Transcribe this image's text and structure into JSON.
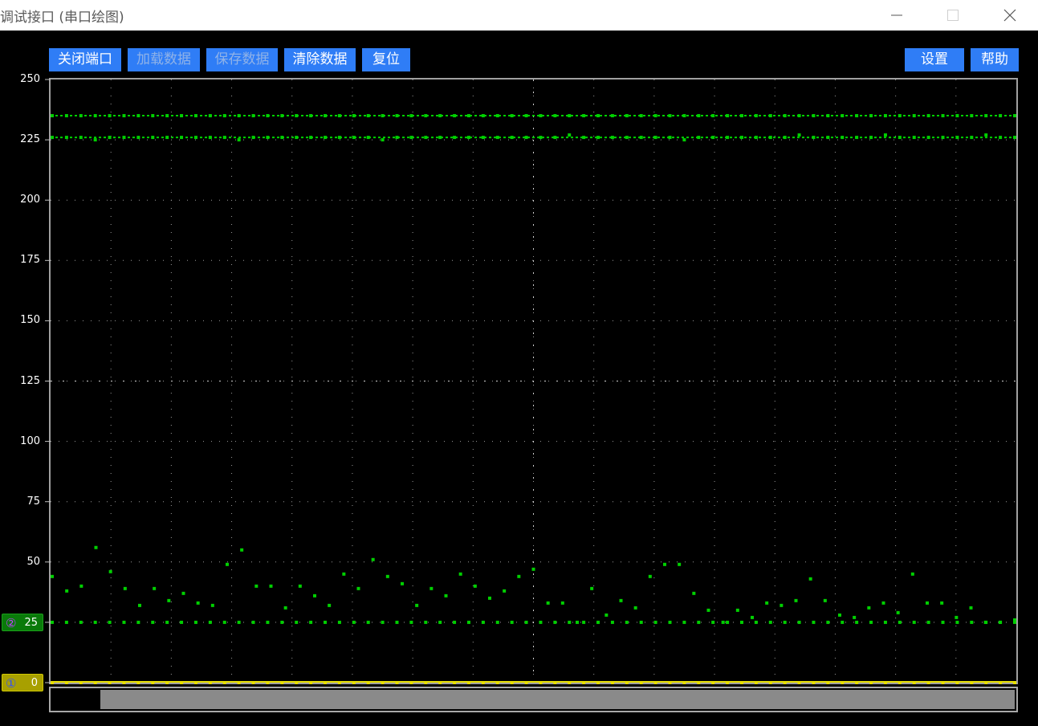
{
  "window": {
    "title": "调试接口 (串口绘图)",
    "minimize_icon": "minimize-icon",
    "maximize_icon": "maximize-icon",
    "close_icon": "close-icon"
  },
  "toolbar": {
    "close_port": "关闭端口",
    "load_data": "加载数据",
    "save_data": "保存数据",
    "clear_data": "清除数据",
    "reset": "复位",
    "settings": "设置",
    "help": "帮助"
  },
  "colors": {
    "button_bg": "#2f7df6",
    "grid": "#9a9a9a",
    "series_1": "#e8e000",
    "series_2": "#00d000",
    "series_2_marker_bg": "#0a7a0a",
    "series_1_marker_bg": "#a8a000"
  },
  "channels": [
    {
      "number": "②",
      "value": "25"
    },
    {
      "number": "①",
      "value": "0"
    }
  ],
  "chart_data": {
    "type": "scatter",
    "ylim": [
      0,
      250
    ],
    "yticks": [
      "250",
      "225",
      "200",
      "175",
      "150",
      "125",
      "100",
      "75",
      "50",
      "25",
      "0"
    ],
    "grid": true,
    "series": [
      {
        "color": "#00d000",
        "values": [
          235,
          235,
          235,
          235,
          235,
          235,
          235,
          235,
          235,
          235,
          235,
          235,
          235,
          235,
          235,
          235,
          235,
          235,
          235,
          235,
          235,
          235,
          235,
          235,
          235,
          235,
          235,
          235,
          235,
          235,
          235,
          235,
          235,
          235,
          235,
          235,
          235,
          235,
          235,
          235,
          235,
          235,
          235,
          235,
          235,
          235,
          235,
          235,
          235,
          235,
          235,
          235,
          235,
          235,
          235,
          235,
          235,
          235,
          235,
          235,
          235,
          235,
          235,
          235,
          235,
          235,
          235,
          235
        ]
      },
      {
        "color": "#00d000",
        "values": [
          226,
          226,
          226,
          225,
          226,
          226,
          226,
          226,
          226,
          226,
          226,
          226,
          226,
          225,
          226,
          226,
          226,
          226,
          226,
          226,
          226,
          226,
          226,
          225,
          226,
          226,
          226,
          226,
          226,
          226,
          226,
          226,
          226,
          226,
          226,
          226,
          227,
          226,
          226,
          226,
          226,
          226,
          226,
          226,
          225,
          226,
          226,
          226,
          226,
          226,
          226,
          226,
          227,
          226,
          226,
          226,
          226,
          226,
          227,
          226,
          226,
          226,
          226,
          226,
          226,
          227,
          226,
          226
        ]
      },
      {
        "color": "#00d000",
        "values": [
          44,
          38,
          40,
          56,
          46,
          39,
          32,
          39,
          34,
          37,
          33,
          32,
          49,
          55,
          40,
          40,
          31,
          40,
          36,
          32,
          45,
          39,
          51,
          44,
          41,
          32,
          39,
          36,
          45,
          40,
          35,
          38,
          44,
          47,
          33,
          33,
          25,
          39,
          28,
          34,
          31,
          44,
          49,
          49,
          37,
          30,
          25,
          30,
          27,
          33,
          32,
          34,
          43,
          34,
          28,
          27,
          31,
          33,
          29,
          45,
          33,
          33,
          27,
          31,
          25,
          25,
          26
        ]
      },
      {
        "color": "#00d000",
        "values": [
          25,
          25,
          25,
          25,
          25,
          25,
          25,
          25,
          25,
          25,
          25,
          25,
          25,
          25,
          25,
          25,
          25,
          25,
          25,
          25,
          25,
          25,
          25,
          25,
          25,
          25,
          25,
          25,
          25,
          25,
          25,
          25,
          25,
          25,
          25,
          25,
          25,
          25,
          25,
          25,
          25,
          25,
          25,
          25,
          25,
          25,
          25,
          25,
          25,
          25,
          25,
          25,
          25,
          25,
          25,
          25,
          25,
          25,
          25,
          25,
          25,
          25,
          25,
          25,
          25,
          25,
          25,
          25
        ]
      },
      {
        "color": "#e8e000",
        "values": [
          0,
          0,
          0,
          0,
          0,
          0,
          0,
          0,
          0,
          0,
          0,
          0,
          0,
          0,
          0,
          0,
          0,
          0,
          0,
          0,
          0,
          0,
          0,
          0,
          0,
          0,
          0,
          0,
          0,
          0,
          0,
          0,
          0,
          0,
          0,
          0,
          0,
          0,
          0,
          0,
          0,
          0,
          0,
          0,
          0,
          0,
          0,
          0,
          0,
          0,
          0,
          0,
          0,
          0,
          0,
          0,
          0,
          0,
          0,
          0,
          0,
          0,
          0,
          0,
          0,
          0,
          0,
          0
        ]
      }
    ]
  },
  "scrollbar": {
    "position": 0.0,
    "visible_fraction": 0.95
  }
}
